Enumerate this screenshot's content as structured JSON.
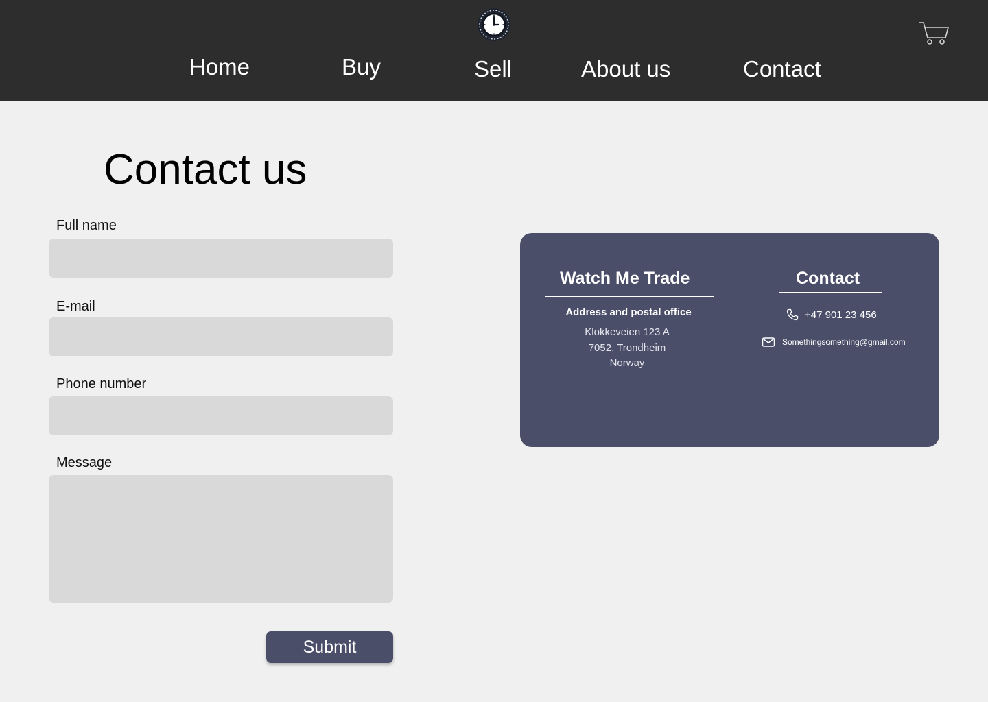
{
  "header": {
    "nav": [
      {
        "label": "Home"
      },
      {
        "label": "Buy"
      },
      {
        "label": "Sell"
      },
      {
        "label": "About us"
      },
      {
        "label": "Contact"
      }
    ],
    "logo_icon": "clock-icon",
    "cart_icon": "shopping-cart-icon"
  },
  "main": {
    "title": "Contact us",
    "form": {
      "full_name_label": "Full name",
      "full_name_value": "",
      "email_label": "E-mail",
      "email_value": "",
      "phone_label": "Phone number",
      "phone_value": "",
      "message_label": "Message",
      "message_value": "",
      "submit_label": "Submit"
    }
  },
  "info_card": {
    "company_heading": "Watch Me Trade",
    "address_title": "Address and postal office",
    "address_lines": [
      "Klokkeveien 123 A",
      "7052, Trondheim",
      "Norway"
    ],
    "contact_heading": "Contact",
    "phone": "+47 901 23 456",
    "phone_icon": "phone-icon",
    "email": "Somethingsomething@gmail.com",
    "email_icon": "envelope-icon"
  },
  "colors": {
    "header_bg": "#2d2d2d",
    "page_bg": "#f0f0f0",
    "accent": "#4a4e69",
    "input_bg": "#d9d9d9"
  }
}
